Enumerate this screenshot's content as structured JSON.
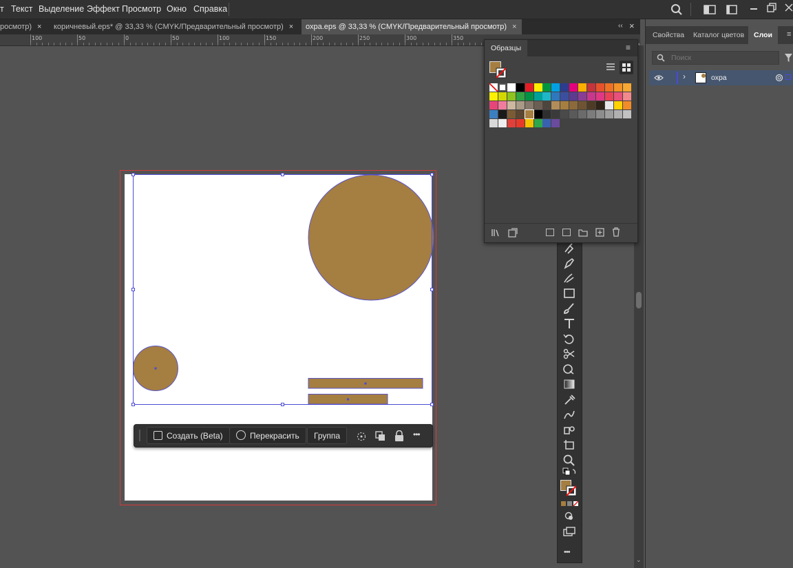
{
  "menu": {
    "items": [
      "Текст",
      "Выделение",
      "Эффект",
      "Просмотр",
      "Окно",
      "Справка"
    ]
  },
  "tabs": [
    {
      "label": "росмотр)",
      "close": "×"
    },
    {
      "label": "коричневый.eps* @ 33,33 % (CMYK/Предварительный просмотр)",
      "close": "×"
    },
    {
      "label": "охра.eps @ 33,33 % (CMYK/Предварительный просмотр)",
      "close": "×"
    }
  ],
  "ruler": {
    "labels": [
      "100",
      "50",
      "0",
      "50",
      "100",
      "150",
      "200",
      "250",
      "300",
      "350"
    ]
  },
  "right_panel": {
    "tabs": [
      "Свойства",
      "Каталог цветов",
      "Слои"
    ],
    "search_placeholder": "Поиск",
    "layer_name": "охра"
  },
  "swatches_panel": {
    "title": "Образцы",
    "current_fill": "#a57e41",
    "rows": [
      [
        "none",
        "reg",
        "#ffffff",
        "#000000",
        "#e31e24",
        "#ffed00",
        "#00963f",
        "#00a0e3",
        "#2c3d8f",
        "#e4007c",
        "#f9b000",
        "#c4343c",
        "#e6522c",
        "#ee7124",
        "#f29227",
        "#f7a733"
      ],
      [
        "#fff100",
        "#d3d800",
        "#8fc31f",
        "#31a342",
        "#009245",
        "#00a199",
        "#1fb6c8",
        "#2f78be",
        "#3b4fa0",
        "#5c3b91",
        "#8a3d94",
        "#c8378b",
        "#e03885",
        "#e94258",
        "#e7517a",
        "#f2898d"
      ],
      [
        "#e6457a",
        "#f07c9d",
        "#cbb89f",
        "#a89a86",
        "#86796b",
        "#6b5f53",
        "#4d463f",
        "#b28d5a",
        "#a57e41",
        "#8c6a3a",
        "#6e5432",
        "#4e3b25",
        "#2f2417",
        "#e8e8e8",
        "#ffd200",
        "#f28c28"
      ],
      [
        "#3c7fc1",
        "#1a1a1a",
        "#7b5b35",
        "#5a4631",
        "#a57e41",
        "#000000",
        "#2e2e2e",
        "#3a3a3a",
        "#4a4a4a",
        "#5a5a5a",
        "#6b6b6b",
        "#7c7c7c",
        "#8d8d8d",
        "#9e9e9e",
        "#b0b0b0",
        "#c2c2c2"
      ],
      [
        "#d9d9d9",
        "#eeeeee",
        "#e0403a",
        "#e6392b",
        "#f3c300",
        "#2fa74a",
        "#3a61b0",
        "#6a4b9e"
      ]
    ]
  },
  "artwork": {
    "ochre": "#a57e41",
    "selection_color": "#4b4bd6"
  },
  "context_bar": {
    "create_label": "Создать (Beta)",
    "recolor_label": "Перекрасить",
    "group_label": "Группа",
    "more": "•••"
  },
  "tools_panel": {
    "more": "•••"
  }
}
